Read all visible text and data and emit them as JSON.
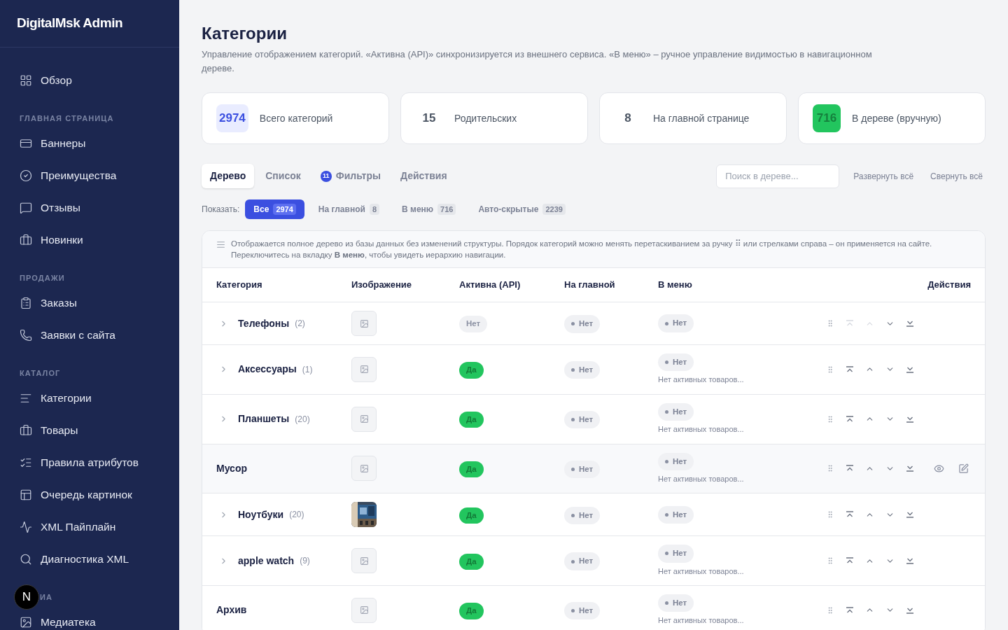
{
  "sidebar": {
    "brand": "DigitalMsk Admin",
    "items": [
      {
        "kind": "item",
        "label": "Обзор"
      },
      {
        "kind": "section",
        "label": "ГЛАВНАЯ СТРАНИЦА"
      },
      {
        "kind": "item",
        "label": "Баннеры"
      },
      {
        "kind": "item",
        "label": "Преимущества"
      },
      {
        "kind": "item",
        "label": "Отзывы"
      },
      {
        "kind": "item",
        "label": "Новинки"
      },
      {
        "kind": "section",
        "label": "ПРОДАЖИ"
      },
      {
        "kind": "item",
        "label": "Заказы"
      },
      {
        "kind": "item",
        "label": "Заявки с сайта"
      },
      {
        "kind": "section",
        "label": "КАТАЛОГ"
      },
      {
        "kind": "item",
        "label": "Категории"
      },
      {
        "kind": "item",
        "label": "Товары"
      },
      {
        "kind": "item",
        "label": "Правила атрибутов"
      },
      {
        "kind": "item",
        "label": "Очередь картинок"
      },
      {
        "kind": "item",
        "label": "XML Пайплайн"
      },
      {
        "kind": "item",
        "label": "Диагностика XML"
      },
      {
        "kind": "section",
        "label": "ИА",
        "badge": "N"
      },
      {
        "kind": "item",
        "label": "Медиатека"
      }
    ]
  },
  "page": {
    "title": "Категории",
    "subtitle": "Управление отображением категорий. «Активна (API)» синхронизируется из внешнего сервиса. «В меню» – ручное управление видимостью в навигационном дереве."
  },
  "stats": [
    {
      "kind": "blue",
      "value": "2974",
      "label": "Всего категорий"
    },
    {
      "kind": "plain",
      "value": "15",
      "label": "Родительских"
    },
    {
      "kind": "plain",
      "value": "8",
      "label": "На главной странице"
    },
    {
      "kind": "green",
      "value": "716",
      "label": "В дереве (вручную)"
    }
  ],
  "tabs": [
    {
      "label": "Дерево",
      "selected": true
    },
    {
      "label": "Список",
      "selected": false
    },
    {
      "label": "Фильтры",
      "badge": "11",
      "selected": false
    },
    {
      "label": "Действия",
      "selected": false
    }
  ],
  "search": {
    "placeholder": "Поиск в дереве..."
  },
  "tree_links": [
    "Развернуть всё",
    "Свернуть всё"
  ],
  "filter": {
    "label": "Показать:",
    "chips": [
      {
        "label": "Все",
        "count": "2974",
        "selected": true
      },
      {
        "label": "На главной",
        "count": "8",
        "selected": false
      },
      {
        "label": "В меню",
        "count": "716",
        "selected": false
      },
      {
        "label": "Авто-скрытые",
        "count": "2239",
        "selected": false
      }
    ]
  },
  "notice": "Отображается полное дерево из базы данных без изменений структуры. Порядок категорий можно менять перетаскиванием за ручку ⠿ или стрелками справа – он применяется на сайте. Переключитесь на вкладку **В меню**, чтобы увидеть иерархию навигации.",
  "table": {
    "columns": [
      "Категория",
      "Изображение",
      "Активна (API)",
      "На главной",
      "В меню",
      "Действия"
    ],
    "rows": [
      {
        "kind": "parent",
        "name": "Телефоны",
        "count": "(2)",
        "image": {
          "kind": "placeholder"
        },
        "active": {
          "text": "Нет",
          "on": false
        },
        "main": "Нет",
        "menu": "Нет",
        "up_disabled": true,
        "selected": false
      },
      {
        "kind": "parent",
        "name": "Аксессуары",
        "count": "(1)",
        "image": {
          "kind": "placeholder"
        },
        "active": {
          "text": "Да",
          "on": true
        },
        "main": "Нет",
        "menu": "Нет",
        "menu_note": "Нет активных товаров...",
        "up_disabled": false,
        "selected": false
      },
      {
        "kind": "parent",
        "name": "Планшеты",
        "count": "(20)",
        "image": {
          "kind": "placeholder"
        },
        "active": {
          "text": "Да",
          "on": true
        },
        "main": "Нет",
        "menu": "Нет",
        "menu_note": "Нет активных товаров...",
        "up_disabled": false,
        "selected": false
      },
      {
        "kind": "leaf",
        "name": "Мусор",
        "image": {
          "kind": "placeholder"
        },
        "active": {
          "text": "Да",
          "on": true
        },
        "main": "Нет",
        "menu": "Нет",
        "menu_note": "Нет активных товаров...",
        "up_disabled": false,
        "selected": true
      },
      {
        "kind": "parent",
        "name": "Ноутбуки",
        "count": "(20)",
        "active": {
          "text": "Да",
          "on": true
        },
        "main": "Нет",
        "menu": "Нет",
        "up_disabled": false,
        "selected": false
      },
      {
        "kind": "parent",
        "name": "apple watch",
        "count": "(9)",
        "image": {
          "kind": "placeholder"
        },
        "active": {
          "text": "Да",
          "on": true
        },
        "main": "Нет",
        "menu": "Нет",
        "menu_note": "Нет активных товаров...",
        "up_disabled": false,
        "selected": false
      },
      {
        "kind": "leaf",
        "name": "Архив",
        "image": {
          "kind": "placeholder"
        },
        "active": {
          "text": "Да",
          "on": true
        },
        "main": "Нет",
        "menu": "Нет",
        "menu_note": "Нет активных товаров...",
        "up_disabled": false,
        "selected": false
      }
    ]
  }
}
